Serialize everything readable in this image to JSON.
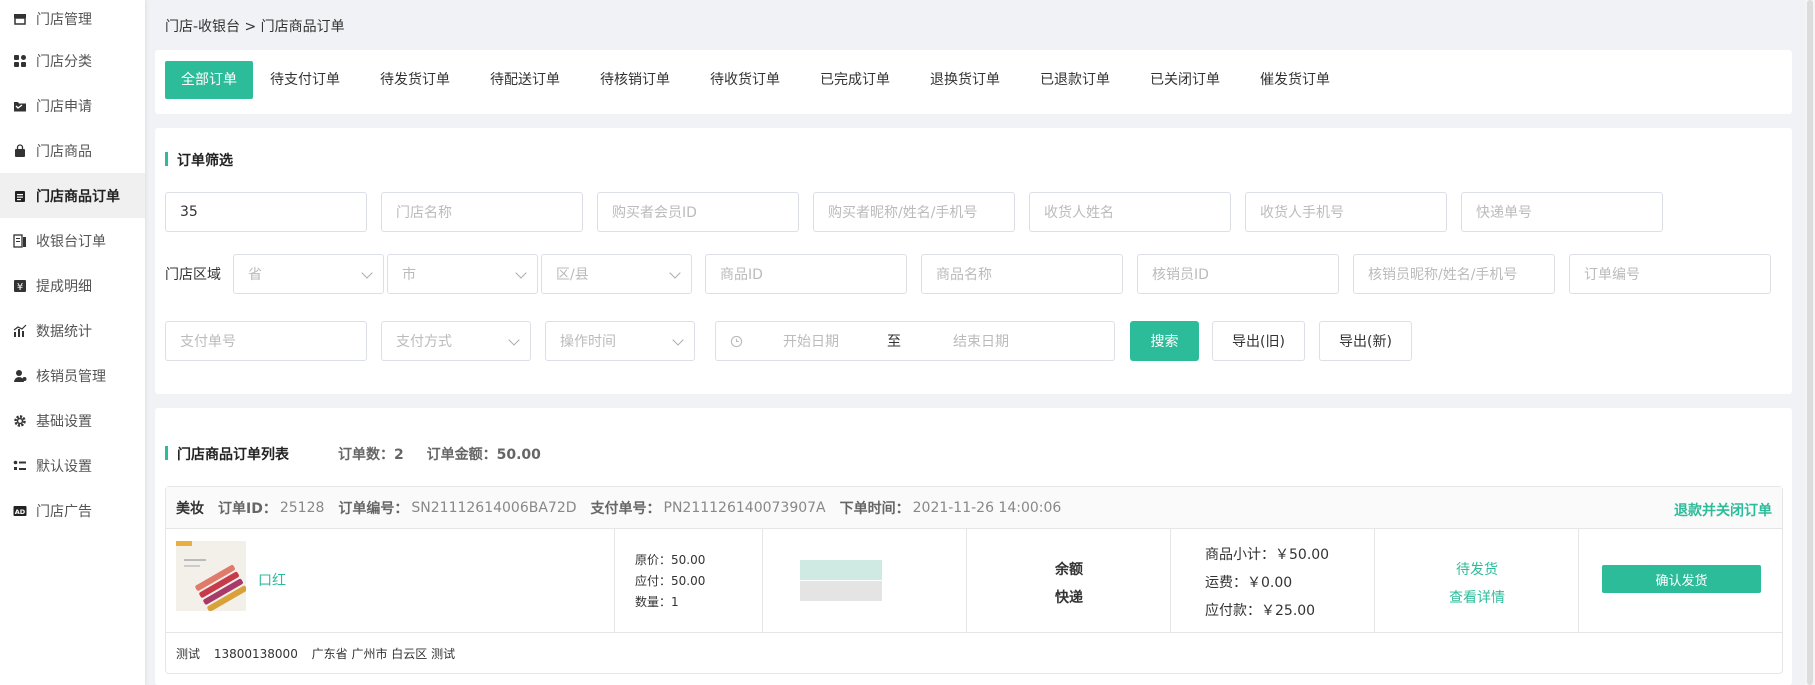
{
  "sidebar": {
    "items": [
      {
        "label": "门店管理",
        "icon": "store-icon"
      },
      {
        "label": "门店分类",
        "icon": "category-icon"
      },
      {
        "label": "门店申请",
        "icon": "folder-icon"
      },
      {
        "label": "门店商品",
        "icon": "bag-icon"
      },
      {
        "label": "门店商品订单",
        "icon": "clipboard-icon",
        "active": true
      },
      {
        "label": "收银台订单",
        "icon": "receipt-icon"
      },
      {
        "label": "提成明细",
        "icon": "yen-icon"
      },
      {
        "label": "数据统计",
        "icon": "chart-icon"
      },
      {
        "label": "核销员管理",
        "icon": "user-icon"
      },
      {
        "label": "基础设置",
        "icon": "gear-icon"
      },
      {
        "label": "默认设置",
        "icon": "list-icon"
      },
      {
        "label": "门店广告",
        "icon": "ad-icon"
      }
    ]
  },
  "breadcrumb": "门店-收银台 > 门店商品订单",
  "tabs": [
    "全部订单",
    "待支付订单",
    "待发货订单",
    "待配送订单",
    "待核销订单",
    "待收货订单",
    "已完成订单",
    "退换货订单",
    "已退款订单",
    "已关闭订单",
    "催发货订单"
  ],
  "filter": {
    "title": "订单筛选",
    "row1": {
      "store_id_value": "35",
      "store_name_placeholder": "门店名称",
      "buyer_id_placeholder": "购买者会员ID",
      "buyer_info_placeholder": "购买者昵称/姓名/手机号",
      "receiver_name_placeholder": "收货人姓名",
      "receiver_phone_placeholder": "收货人手机号",
      "express_no_placeholder": "快递单号"
    },
    "row2": {
      "region_label": "门店区域",
      "province_placeholder": "省",
      "city_placeholder": "市",
      "district_placeholder": "区/县",
      "goods_id_placeholder": "商品ID",
      "goods_name_placeholder": "商品名称",
      "verifier_id_placeholder": "核销员ID",
      "verifier_info_placeholder": "核销员昵称/姓名/手机号",
      "order_no_placeholder": "订单编号"
    },
    "row3": {
      "pay_no_placeholder": "支付单号",
      "pay_method_placeholder": "支付方式",
      "op_time_placeholder": "操作时间",
      "start_date_placeholder": "开始日期",
      "date_sep": "至",
      "end_date_placeholder": "结束日期",
      "search_label": "搜索",
      "export_old_label": "导出(旧)",
      "export_new_label": "导出(新)"
    }
  },
  "list": {
    "title": "门店商品订单列表",
    "count_text": "订单数：2",
    "amount_text": "订单金额：50.00",
    "order": {
      "store": "美妆",
      "id_label": "订单ID：",
      "id": "25128",
      "no_label": "订单编号：",
      "no": "SN21112614006BA72D",
      "pay_no_label": "支付单号：",
      "pay_no": "PN211126140073907A",
      "time_label": "下单时间：",
      "time": "2021-11-26 14:00:06",
      "action": "退款并关闭订单",
      "product_name": "口红",
      "original_price": "原价：50.00",
      "payable": "应付：50.00",
      "quantity": "数量：1",
      "pay_type": "余额",
      "delivery": "快递",
      "subtotal": "商品小计：￥50.00",
      "freight": "运费：￥0.00",
      "payable_total": "应付款：￥25.00",
      "status": "待发货",
      "detail_link": "查看详情",
      "ship_button": "确认发货",
      "receiver_name": "测试",
      "receiver_phone": "13800138000",
      "receiver_address": "广东省 广州市 白云区 测试"
    }
  },
  "colors": {
    "accent": "#2dbc9a"
  }
}
